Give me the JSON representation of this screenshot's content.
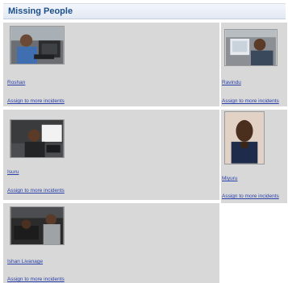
{
  "panel": {
    "title": "Missing People"
  },
  "people": [
    {
      "name": "Roshan",
      "assign_label": "Assign to more incidents"
    },
    {
      "name": "Ravindu",
      "assign_label": "Assign to more incidents"
    },
    {
      "name": "Isuru",
      "assign_label": "Assign to more incidents"
    },
    {
      "name": "Miyuru",
      "assign_label": "Assign to more incidents"
    },
    {
      "name": "Ishan Livanage",
      "assign_label": "Assign to more incidents"
    }
  ]
}
